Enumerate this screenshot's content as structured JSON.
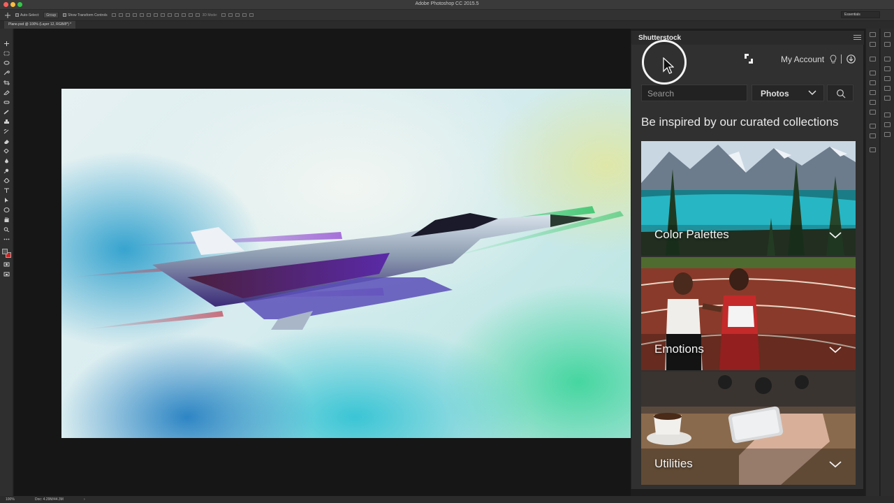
{
  "window": {
    "app_title": "Adobe Photoshop CC 2015.5"
  },
  "options_bar": {
    "auto_select_label": "Auto-Select:",
    "auto_select_value": "Group",
    "show_transform_label": "Show Transform Controls",
    "mode_3d_label": "3D Mode:",
    "workspace": "Essentials"
  },
  "document": {
    "tab_label": "Plane.psd @ 100% (Layer 12, RGB/8*) *"
  },
  "status_bar": {
    "zoom": "100%",
    "doc_size": "Doc: 4.29M/44.3M",
    "arrow": "›"
  },
  "panel": {
    "tab_label": "Shutterstock",
    "my_account": "My Account",
    "search_placeholder": "Search",
    "type_select": "Photos",
    "heading": "Be inspired by our curated collections",
    "collections": [
      {
        "label": "Color Palettes"
      },
      {
        "label": "Emotions"
      },
      {
        "label": "Utilities"
      }
    ]
  },
  "colors": {
    "foreground_swatch": "#555555",
    "background_swatch": "#d12020",
    "panel_bg": "#303030",
    "canvas_bg": "#161616"
  },
  "icons": [
    "move-icon",
    "marquee-icon",
    "lasso-icon",
    "crop-icon",
    "brush-icon",
    "type-icon",
    "hand-icon",
    "zoom-icon",
    "shutterstock-logo-icon",
    "lightbulb-icon",
    "download-icon",
    "search-icon",
    "chevron-down-icon",
    "panel-menu-icon"
  ]
}
